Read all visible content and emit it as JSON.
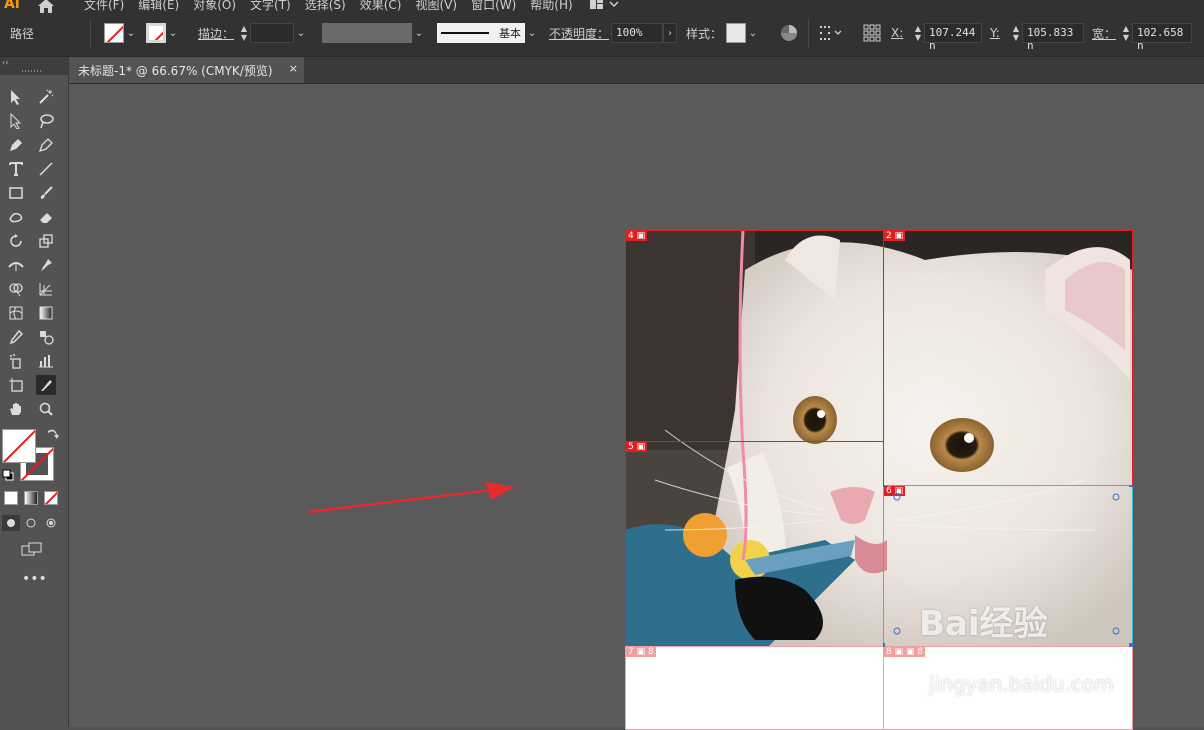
{
  "app": {
    "logo": "Ai",
    "menu": [
      "文件(F)",
      "编辑(E)",
      "对象(O)",
      "文字(T)",
      "选择(S)",
      "效果(C)",
      "视图(V)",
      "窗口(W)",
      "帮助(H)"
    ]
  },
  "control": {
    "selection_type": "路径",
    "stroke_label": "描边：",
    "stroke_profile": "基本",
    "opacity_label": "不透明度：",
    "opacity_value": "100%",
    "style_label": "样式：",
    "x_label": "X:",
    "x_value": "107.244 n",
    "y_label": "Y:",
    "y_value": "105.833 n",
    "w_label": "宽：",
    "w_value": "102.658 n"
  },
  "document": {
    "tab_title": "未标题-1* @ 66.67% (CMYK/预览)",
    "tab_close": "×"
  },
  "slices": [
    {
      "number": "4"
    },
    {
      "number": "2"
    },
    {
      "number": "5"
    },
    {
      "number": "6"
    },
    {
      "number": "7"
    },
    {
      "number": "8"
    }
  ],
  "watermark": {
    "brand": "Bai经验",
    "url": "jingyan.baidu.com"
  },
  "colors": {
    "menubar": "#323232",
    "canvas": "#5a5a5a",
    "slice_red": "#e02020",
    "slice_cyan": "#3fb6d6",
    "arrow": "#e52b2b",
    "logo_orange": "#ff9a00"
  },
  "icons": {
    "home": "home-icon",
    "workspace": "workspace-switcher-icon",
    "recolor": "recolor-artwork-icon",
    "align": "align-icon",
    "transform": "transform-reference-icon"
  }
}
